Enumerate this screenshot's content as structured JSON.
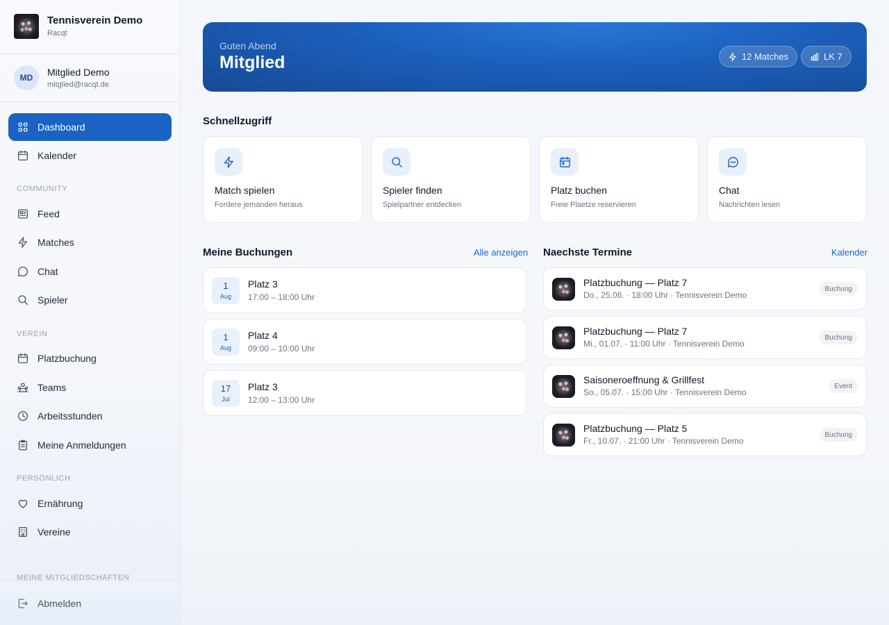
{
  "brand": {
    "title": "Tennisverein Demo",
    "subtitle": "Racqt"
  },
  "user": {
    "initials": "MD",
    "name": "Mitglied Demo",
    "email": "mitglied@racqt.de"
  },
  "nav": {
    "dashboard": "Dashboard",
    "kalender": "Kalender",
    "section_community": "Community",
    "feed": "Feed",
    "matches": "Matches",
    "chat": "Chat",
    "spieler": "Spieler",
    "section_verein": "Verein",
    "platzbuchung": "Platzbuchung",
    "teams": "Teams",
    "arbeitsstunden": "Arbeitsstunden",
    "anmeldungen": "Meine Anmeldungen",
    "section_persoenlich": "Persönlich",
    "ernaehrung": "Ernährung",
    "vereine": "Vereine",
    "section_mitgliedschaften": "Meine Mitgliedschaften",
    "abmelden": "Abmelden"
  },
  "hero": {
    "greeting": "Guten Abend",
    "name": "Mitglied",
    "stat_matches": "12 Matches",
    "stat_lk": "LK 7"
  },
  "quick": {
    "title": "Schnellzugriff",
    "items": [
      {
        "title": "Match spielen",
        "subtitle": "Fordere jemanden heraus",
        "icon": "bolt-icon"
      },
      {
        "title": "Spieler finden",
        "subtitle": "Spielpartner entdecken",
        "icon": "search-icon"
      },
      {
        "title": "Platz buchen",
        "subtitle": "Freie Plaetze reservieren",
        "icon": "calendar-icon"
      },
      {
        "title": "Chat",
        "subtitle": "Nachrichten lesen",
        "icon": "chat-icon"
      }
    ]
  },
  "bookings": {
    "title": "Meine Buchungen",
    "link": "Alle anzeigen",
    "items": [
      {
        "day": "1",
        "month": "Aug",
        "court": "Platz 3",
        "time": "17:00 – 18:00 Uhr"
      },
      {
        "day": "1",
        "month": "Aug",
        "court": "Platz 4",
        "time": "09:00 – 10:00 Uhr"
      },
      {
        "day": "17",
        "month": "Jul",
        "court": "Platz 3",
        "time": "12:00 – 13:00 Uhr"
      }
    ]
  },
  "events": {
    "title": "Naechste Termine",
    "link": "Kalender",
    "items": [
      {
        "title": "Platzbuchung — Platz 7",
        "meta": "Do., 25.06. · 18:00 Uhr · Tennisverein Demo",
        "badge": "Buchung"
      },
      {
        "title": "Platzbuchung — Platz 7",
        "meta": "Mi., 01.07. · 11:00 Uhr · Tennisverein Demo",
        "badge": "Buchung"
      },
      {
        "title": "Saisoneroeffnung & Grillfest",
        "meta": "So., 05.07. · 15:00 Uhr · Tennisverein Demo",
        "badge": "Event"
      },
      {
        "title": "Platzbuchung — Platz 5",
        "meta": "Fr., 10.07. · 21:00 Uhr · Tennisverein Demo",
        "badge": "Buchung"
      }
    ]
  },
  "colors": {
    "accent": "#1a63c4",
    "hero_dark": "#174a95",
    "sidebar_bg": "#f5f7fb"
  }
}
